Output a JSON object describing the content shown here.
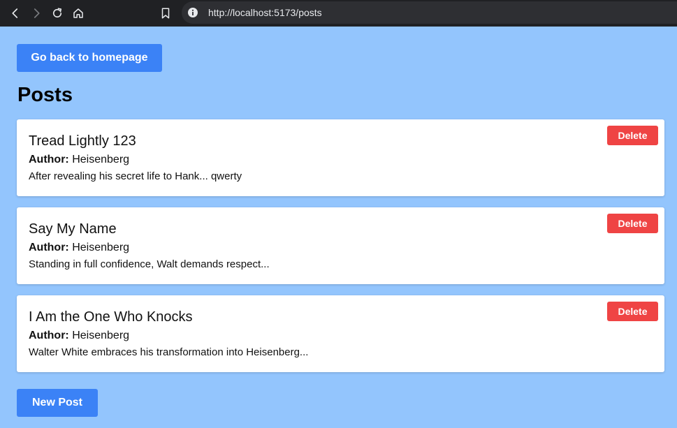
{
  "browser": {
    "url": "http://localhost:5173/posts",
    "icons": [
      "back-icon",
      "forward-icon",
      "reload-icon",
      "home-icon",
      "bookmark-icon",
      "site-info-icon"
    ]
  },
  "page": {
    "back_button_label": "Go back to homepage",
    "title": "Posts",
    "new_post_label": "New Post",
    "author_label": "Author:",
    "delete_label": "Delete"
  },
  "posts": [
    {
      "title": "Tread Lightly 123",
      "author": "Heisenberg",
      "excerpt": "After revealing his secret life to Hank... qwerty"
    },
    {
      "title": "Say My Name",
      "author": "Heisenberg",
      "excerpt": "Standing in full confidence, Walt demands respect..."
    },
    {
      "title": "I Am the One Who Knocks",
      "author": "Heisenberg",
      "excerpt": "Walter White embraces his transformation into Heisenberg..."
    }
  ],
  "colors": {
    "background": "#93c5fd",
    "primary": "#3b82f6",
    "danger": "#ef4444",
    "card": "#ffffff"
  }
}
